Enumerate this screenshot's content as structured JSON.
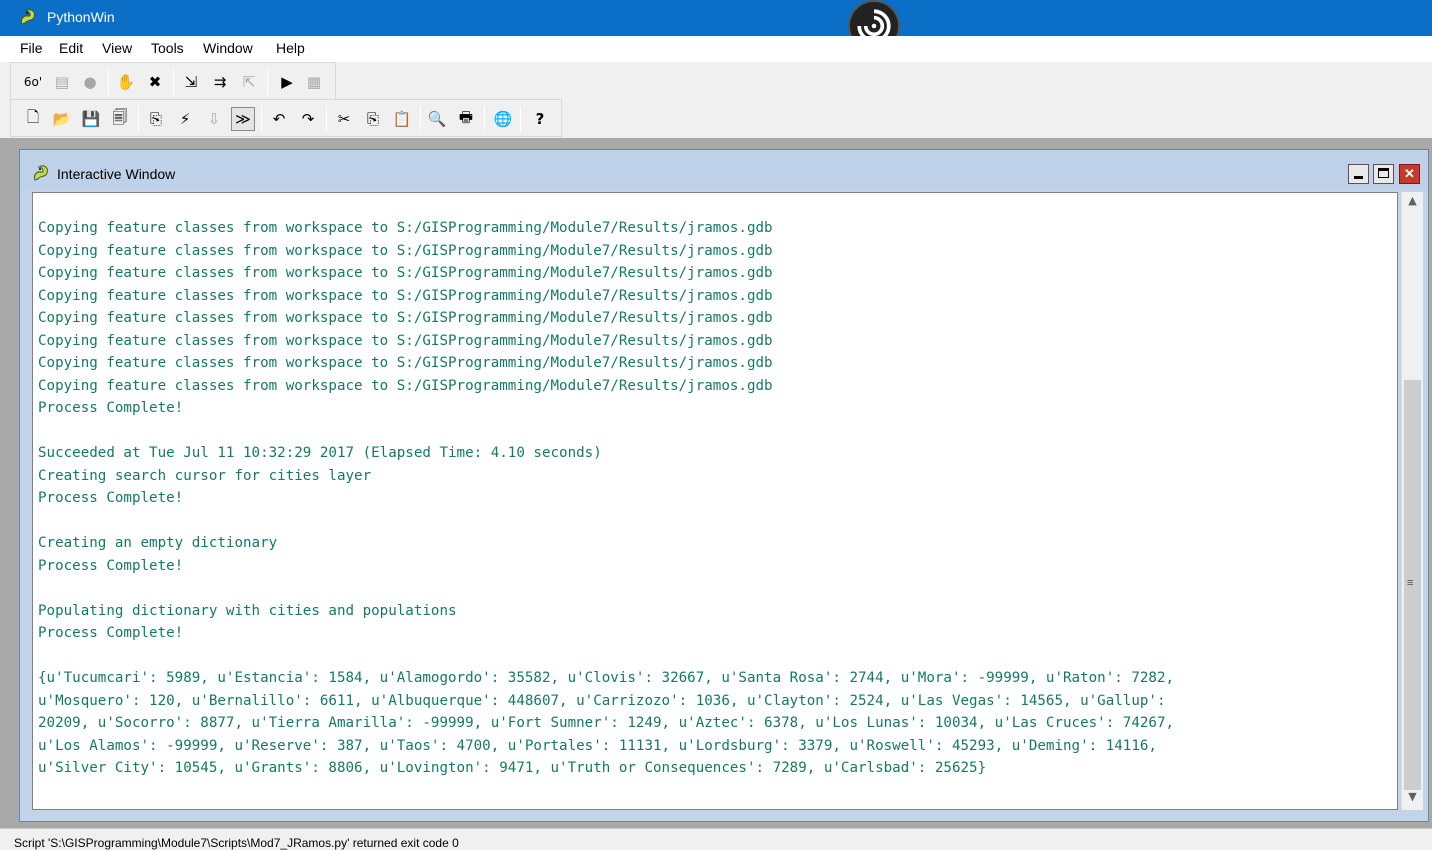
{
  "app": {
    "title": "PythonWin",
    "icon": "python-snake-icon"
  },
  "menu": [
    "File",
    "Edit",
    "View",
    "Tools",
    "Window",
    "Help"
  ],
  "toolbar1": [
    {
      "name": "watch-icon",
      "glyph": "6o'"
    },
    {
      "name": "breakpoint-list-icon",
      "glyph": "▤"
    },
    {
      "name": "stop-icon",
      "glyph": "●"
    },
    {
      "name": "hand-icon",
      "glyph": "✋"
    },
    {
      "name": "clear-breakpoints-icon",
      "glyph": "✖"
    },
    {
      "name": "step-icon",
      "glyph": "⇲"
    },
    {
      "name": "step-over-icon",
      "glyph": "⇉"
    },
    {
      "name": "step-out-icon",
      "glyph": "⇱"
    },
    {
      "name": "run-icon",
      "glyph": "▶"
    },
    {
      "name": "close-debugger-icon",
      "glyph": "▦"
    }
  ],
  "toolbar2": [
    {
      "name": "new-icon",
      "glyph": "🗋"
    },
    {
      "name": "open-icon",
      "glyph": "📂"
    },
    {
      "name": "save-icon",
      "glyph": "💾"
    },
    {
      "name": "save-all-icon",
      "glyph": "🗐"
    },
    {
      "name": "check-icon",
      "glyph": "⎘"
    },
    {
      "name": "run-script-icon",
      "glyph": "⚡"
    },
    {
      "name": "import-icon",
      "glyph": "⇩"
    },
    {
      "name": "expand-icon",
      "glyph": "≫"
    },
    {
      "name": "undo-icon",
      "glyph": "↶"
    },
    {
      "name": "redo-icon",
      "glyph": "↷"
    },
    {
      "name": "cut-icon",
      "glyph": "✂"
    },
    {
      "name": "copy-icon",
      "glyph": "⎘"
    },
    {
      "name": "paste-icon",
      "glyph": "📋"
    },
    {
      "name": "print-preview-icon",
      "glyph": "🔍"
    },
    {
      "name": "print-icon",
      "glyph": "🖶"
    },
    {
      "name": "browser-icon",
      "glyph": "🌐"
    },
    {
      "name": "help-icon",
      "glyph": "?"
    }
  ],
  "interactive_window": {
    "title": "Interactive Window",
    "close_glyph": "✕",
    "lines": [
      "Copying feature classes from workspace to S:/GISProgramming/Module7/Results/jramos.gdb",
      "Copying feature classes from workspace to S:/GISProgramming/Module7/Results/jramos.gdb",
      "Copying feature classes from workspace to S:/GISProgramming/Module7/Results/jramos.gdb",
      "Copying feature classes from workspace to S:/GISProgramming/Module7/Results/jramos.gdb",
      "Copying feature classes from workspace to S:/GISProgramming/Module7/Results/jramos.gdb",
      "Copying feature classes from workspace to S:/GISProgramming/Module7/Results/jramos.gdb",
      "Copying feature classes from workspace to S:/GISProgramming/Module7/Results/jramos.gdb",
      "Copying feature classes from workspace to S:/GISProgramming/Module7/Results/jramos.gdb",
      "Process Complete!",
      "",
      "Succeeded at Tue Jul 11 10:32:29 2017 (Elapsed Time: 4.10 seconds)",
      "Creating search cursor for cities layer",
      "Process Complete!",
      "",
      "Creating an empty dictionary",
      "Process Complete!",
      "",
      "Populating dictionary with cities and populations",
      "Process Complete!",
      "",
      "{u'Tucumcari': 5989, u'Estancia': 1584, u'Alamogordo': 35582, u'Clovis': 32667, u'Santa Rosa': 2744, u'Mora': -99999, u'Raton': 7282,",
      "u'Mosquero': 120, u'Bernalillo': 6611, u'Albuquerque': 448607, u'Carrizozo': 1036, u'Clayton': 2524, u'Las Vegas': 14565, u'Gallup':",
      "20209, u'Socorro': 8877, u'Tierra Amarilla': -99999, u'Fort Sumner': 1249, u'Aztec': 6378, u'Los Lunas': 10034, u'Las Cruces': 74267,",
      "u'Los Alamos': -99999, u'Reserve': 387, u'Taos': 4700, u'Portales': 11131, u'Lordsburg': 3379, u'Roswell': 45293, u'Deming': 14116,",
      "u'Silver City': 10545, u'Grants': 8806, u'Lovington': 9471, u'Truth or Consequences': 7289, u'Carlsbad': 25625}"
    ]
  },
  "status_bar": {
    "text": "Script 'S:\\GISProgramming\\Module7\\Scripts\\Mod7_JRamos.py' returned exit code 0"
  },
  "colors": {
    "titlebar": "#0b6fc7",
    "output_text": "#147a62",
    "close_button": "#c7382d"
  }
}
